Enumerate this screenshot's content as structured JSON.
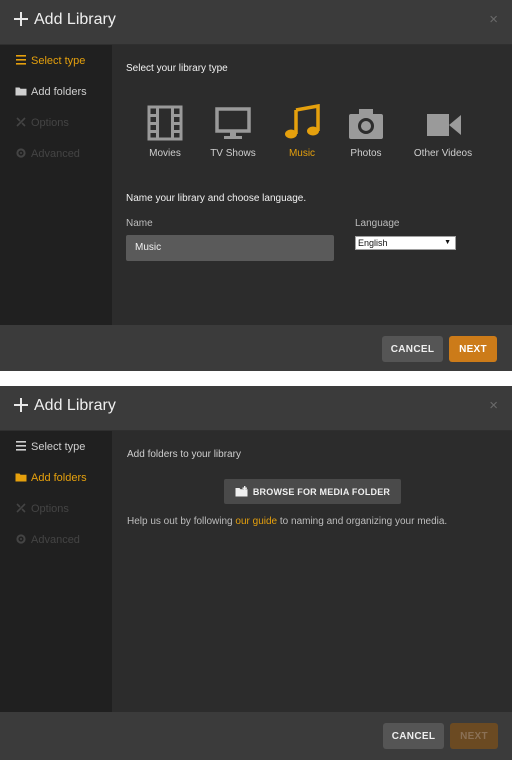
{
  "dialog1": {
    "title": "Add Library",
    "close": "×",
    "sidebar": {
      "items": [
        {
          "label": "Select type",
          "icon": "list-icon",
          "state": "active"
        },
        {
          "label": "Add folders",
          "icon": "folder-icon",
          "state": "normal"
        },
        {
          "label": "Options",
          "icon": "tools-icon",
          "state": "disabled"
        },
        {
          "label": "Advanced",
          "icon": "gear-icon",
          "state": "disabled"
        }
      ]
    },
    "heading": "Select your library type",
    "types": [
      {
        "label": "Movies",
        "icon": "film-icon",
        "selected": false
      },
      {
        "label": "TV Shows",
        "icon": "tv-icon",
        "selected": false
      },
      {
        "label": "Music",
        "icon": "music-note-icon",
        "selected": true
      },
      {
        "label": "Photos",
        "icon": "camera-icon",
        "selected": false
      },
      {
        "label": "Other Videos",
        "icon": "video-camera-icon",
        "selected": false
      }
    ],
    "name_heading": "Name your library and choose language.",
    "name_label": "Name",
    "name_value": "Music",
    "language_label": "Language",
    "language_value": "English",
    "cancel_label": "CANCEL",
    "next_label": "NEXT"
  },
  "dialog2": {
    "title": "Add Library",
    "close": "×",
    "sidebar": {
      "items": [
        {
          "label": "Select type",
          "icon": "list-icon",
          "state": "normal"
        },
        {
          "label": "Add folders",
          "icon": "folder-icon",
          "state": "active"
        },
        {
          "label": "Options",
          "icon": "tools-icon",
          "state": "disabled"
        },
        {
          "label": "Advanced",
          "icon": "gear-icon",
          "state": "disabled"
        }
      ]
    },
    "heading": "Add folders to your library",
    "browse_label": "BROWSE FOR MEDIA FOLDER",
    "help_prefix": "Help us out by following ",
    "help_link": "our guide",
    "help_suffix": " to naming and organizing your media.",
    "cancel_label": "CANCEL",
    "next_label": "NEXT"
  },
  "colors": {
    "accent": "#e5a00d",
    "next_button": "#cc7b19",
    "next_button_disabled": "#6b4a22",
    "header": "#3b3b3b",
    "sidebar": "#202020",
    "content": "#2c2c2c"
  }
}
